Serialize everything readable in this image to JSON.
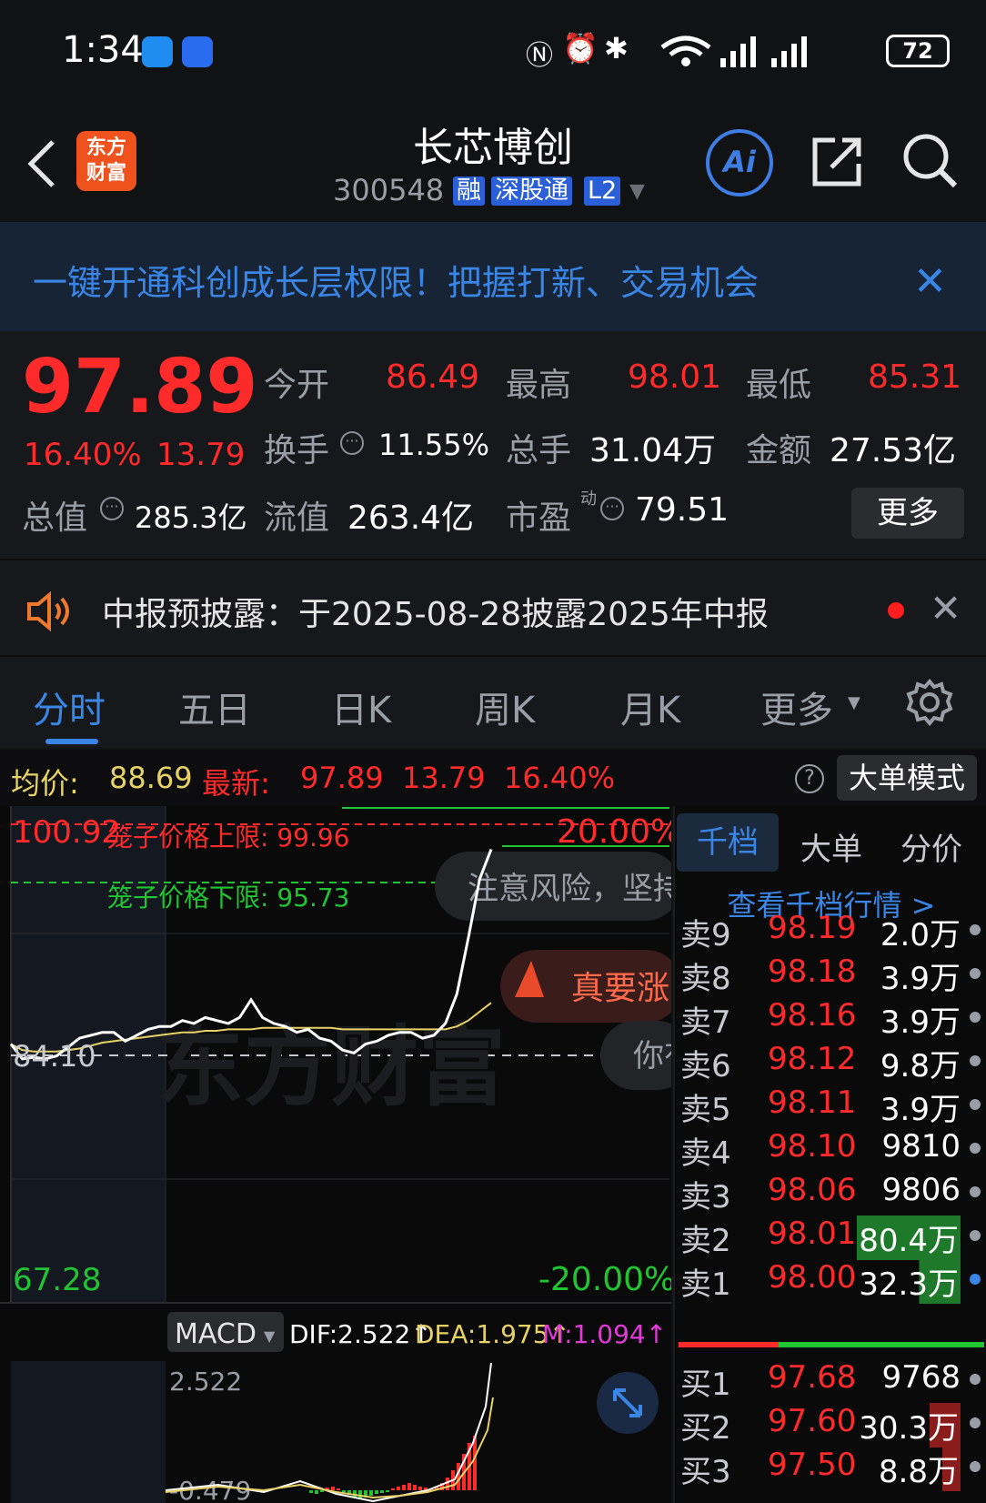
{
  "status_bar": {
    "time": "1:34",
    "battery": "72"
  },
  "header": {
    "back_label": "<",
    "logo_text": "东方财富",
    "stock_name": "长芯博创",
    "stock_code": "300548",
    "tags": [
      "融",
      "深股通",
      "L2"
    ],
    "ai_label": "Ai"
  },
  "banner": {
    "text": "一键开通科创成长层权限！把握打新、交易机会"
  },
  "quote": {
    "price": "97.89",
    "change_pct": "16.40%",
    "change": "13.79",
    "open_label": "今开",
    "open": "86.49",
    "high_label": "最高",
    "high": "98.01",
    "low_label": "最低",
    "low": "85.31",
    "turnover_label": "换手",
    "turnover": "11.55%",
    "volume_label": "总手",
    "volume": "31.04万",
    "amount_label": "金额",
    "amount": "27.53亿",
    "mktcap_label": "总值",
    "mktcap": "285.3亿",
    "float_label": "流值",
    "float_cap": "263.4亿",
    "pe_label": "市盈",
    "pe_sup": "动",
    "pe": "79.51",
    "more_label": "更多"
  },
  "notice": {
    "text": "中报预披露：于2025-08-28披露2025年中报"
  },
  "tabs": [
    "分时",
    "五日",
    "日K",
    "周K",
    "月K",
    "更多"
  ],
  "info_line": {
    "avg_label": "均价:",
    "avg": "88.69",
    "latest_label": "最新:",
    "latest": "97.89",
    "change": "13.79",
    "pct": "16.40%",
    "help": "?",
    "mode_button": "大单模式"
  },
  "chart": {
    "max_label": "100.92",
    "max_pct": "20.00%",
    "cage_upper": "笼子价格上限:  99.96",
    "cage_lower": "笼子价格下限:  95.73",
    "prev_close_label": "84.10",
    "min_label": "67.28",
    "min_pct": "-20.00%",
    "risk_bubble": "注意风险，坚持",
    "promo_bubble": "真要涨",
    "you_bubble": "你有",
    "watermark": "东方财富",
    "macd_select": "MACD",
    "dif": "DIF:2.522↑",
    "dea": "DEA:1.975↑",
    "m": "M:1.094↑",
    "macd_max": "2.522",
    "macd_min": "-0.479",
    "colors": {
      "price_line": "#ffffff",
      "avg_line": "#e8d266",
      "up": "#ff2a2a",
      "down": "#21c531"
    }
  },
  "chart_data": {
    "type": "line",
    "title": "",
    "ylim": [
      67.28,
      100.92
    ],
    "prev_close": 84.1,
    "series": [
      {
        "name": "price",
        "values": [
          84.8,
          83.8,
          83.9,
          83.8,
          84.0,
          84.6,
          85.2,
          85.4,
          85.6,
          85.6,
          85.0,
          85.4,
          85.8,
          86.0,
          86.0,
          86.4,
          86.2,
          86.6,
          86.4,
          86.2,
          86.6,
          87.8,
          86.6,
          86.2,
          86.0,
          85.6,
          85.8,
          85.2,
          85.0,
          84.4,
          84.2,
          84.8,
          85.0,
          85.4,
          85.6,
          85.6,
          85.2,
          85.4,
          86.2,
          88.2,
          92.0,
          96.0,
          98.0
        ]
      },
      {
        "name": "avg",
        "values": [
          84.8,
          84.4,
          84.3,
          84.3,
          84.3,
          84.4,
          84.5,
          84.7,
          84.9,
          85.0,
          85.1,
          85.2,
          85.3,
          85.4,
          85.5,
          85.6,
          85.6,
          85.7,
          85.7,
          85.8,
          85.8,
          85.8,
          85.9,
          85.9,
          85.9,
          85.9,
          85.9,
          85.9,
          85.9,
          85.8,
          85.8,
          85.8,
          85.8,
          85.8,
          85.8,
          85.8,
          85.8,
          85.8,
          85.8,
          86.0,
          86.4,
          87.0,
          87.6
        ]
      }
    ]
  },
  "orderbook": {
    "tabs": [
      "千档",
      "大单",
      "分价"
    ],
    "link": "查看千档行情 >",
    "asks": [
      {
        "side": "卖9",
        "price": "98.19",
        "vol": "2.0万"
      },
      {
        "side": "卖8",
        "price": "98.18",
        "vol": "3.9万"
      },
      {
        "side": "卖7",
        "price": "98.16",
        "vol": "3.9万"
      },
      {
        "side": "卖6",
        "price": "98.12",
        "vol": "9.8万"
      },
      {
        "side": "卖5",
        "price": "98.11",
        "vol": "3.9万"
      },
      {
        "side": "卖4",
        "price": "98.10",
        "vol": "9810"
      },
      {
        "side": "卖3",
        "price": "98.06",
        "vol": "9806"
      },
      {
        "side": "卖2",
        "price": "98.01",
        "vol": "80.4万"
      },
      {
        "side": "卖1",
        "price": "98.00",
        "vol": "32.3万"
      }
    ],
    "bids": [
      {
        "side": "买1",
        "price": "97.68",
        "vol": "9768"
      },
      {
        "side": "买2",
        "price": "97.60",
        "vol": "30.3万"
      },
      {
        "side": "买3",
        "price": "97.50",
        "vol": "8.8万"
      }
    ]
  }
}
